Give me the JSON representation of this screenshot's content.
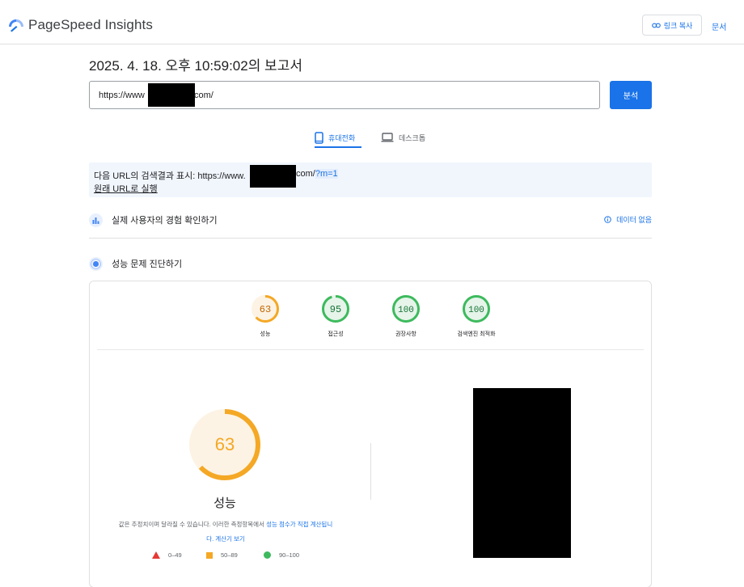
{
  "header": {
    "app_name": "PageSpeed Insights",
    "copy_link_label": "링크 복사",
    "docs_label": "문서"
  },
  "report": {
    "title": "2025. 4. 18. 오후 10:59:02의 보고서",
    "url_prefix": "https://www",
    "url_suffix": "com/",
    "analyze_label": "분석"
  },
  "device_tabs": [
    {
      "label": "휴대전화",
      "icon": "smartphone-icon",
      "active": true
    },
    {
      "label": "데스크톱",
      "icon": "laptop-icon",
      "active": false
    }
  ],
  "redirect": {
    "prefix": "다음 URL의 검색결과 표시: https://www.",
    "suffix_plain": "com/",
    "suffix_highlight": "?m=1",
    "original_link": "원래 URL로 실행"
  },
  "crux": {
    "title": "실제 사용자의 경험 확인하기",
    "no_data_label": "데이터 없음",
    "icon": "user-experience-icon"
  },
  "diagnostics": {
    "title": "성능 문제 진단하기",
    "icon": "lighthouse-icon"
  },
  "scores": [
    {
      "value": 63,
      "label": "성능",
      "color": "#f4a825",
      "track": "#fdf3e4"
    },
    {
      "value": 95,
      "label": "접근성",
      "color": "#3dba5d",
      "track": "#e6f4ea"
    },
    {
      "value": 100,
      "label": "권장사항",
      "color": "#3dba5d",
      "track": "#e6f4ea"
    },
    {
      "value": 100,
      "label": "검색엔진 최적화",
      "color": "#3dba5d",
      "track": "#e6f4ea"
    }
  ],
  "performance": {
    "score": 63,
    "label": "성능",
    "color": "#f4a825",
    "note_plain": "값은 추정치이며 달라질 수 있습니다. 이러한 측정항목에서 ",
    "note_link": "성능 점수가 직접 계산됩니",
    "note_link2": "다. 계산기 보기"
  },
  "legend": [
    {
      "range": "0–49",
      "shape": "triangle",
      "color": "#e53935"
    },
    {
      "range": "50–89",
      "shape": "square",
      "color": "#f4a825"
    },
    {
      "range": "90–100",
      "shape": "circle",
      "color": "#3dba5d"
    }
  ],
  "colors": {
    "accent": "#1a73e8",
    "average": "#f4a825",
    "pass": "#3dba5d",
    "fail": "#e53935"
  }
}
